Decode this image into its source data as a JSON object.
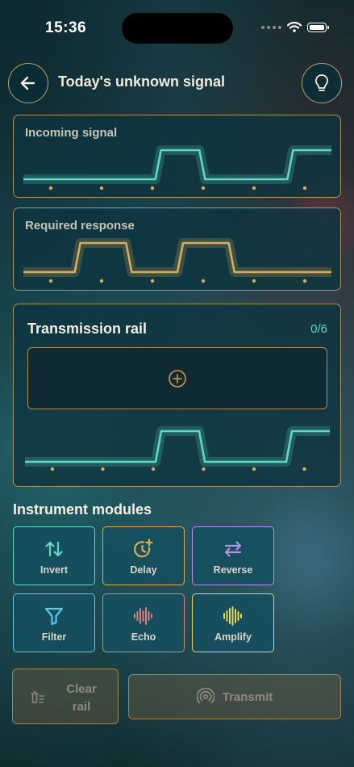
{
  "status_bar": {
    "time": "15:36"
  },
  "header": {
    "title": "Today's unknown signal",
    "back_icon": "arrow-left-icon",
    "hint_icon": "lightbulb-icon"
  },
  "incoming": {
    "label": "Incoming signal",
    "color": "#5fd8c4",
    "pattern": [
      0,
      0,
      0,
      1,
      0,
      0,
      1
    ]
  },
  "required": {
    "label": "Required response",
    "color": "#d8ad5a",
    "pattern": [
      0,
      1,
      0,
      1,
      0,
      0
    ]
  },
  "rail": {
    "title": "Transmission rail",
    "count": "0/6",
    "add_icon": "plus-circle-icon",
    "color": "#5fd8c4",
    "pattern": [
      0,
      0,
      0,
      1,
      0,
      0,
      1
    ]
  },
  "modules": {
    "title": "Instrument modules",
    "items": [
      {
        "label": "Invert",
        "icon": "invert-arrows-icon",
        "color": "#5fd8c4"
      },
      {
        "label": "Delay",
        "icon": "clock-plus-icon",
        "color": "#d8ad5a"
      },
      {
        "label": "Reverse",
        "icon": "swap-arrows-icon",
        "color": "#b392e8"
      },
      {
        "label": "Filter",
        "icon": "filter-funnel-icon",
        "color": "#5fc8e8"
      },
      {
        "label": "Echo",
        "icon": "soundwave-icon",
        "color": "#e07d7d"
      },
      {
        "label": "Amplify",
        "icon": "amplify-wave-icon",
        "color": "#e6d65a"
      }
    ]
  },
  "actions": {
    "clear_line1": "Clear",
    "clear_line2": "rail",
    "transmit": "Transmit"
  }
}
